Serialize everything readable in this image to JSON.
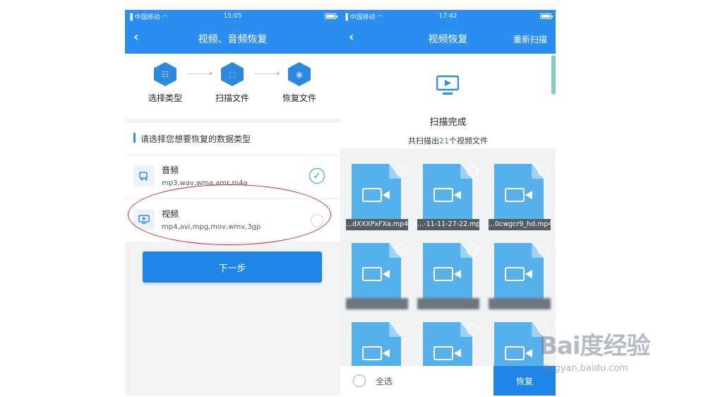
{
  "left_screen": {
    "status": {
      "carrier": "中国移动",
      "time": "15:05"
    },
    "nav": {
      "back_icon": "chevron-left-icon",
      "title": "视频、音频恢复"
    },
    "steps": [
      {
        "label": "选择类型",
        "icon": "grid-icon"
      },
      {
        "label": "扫描文件",
        "icon": "scan-icon"
      },
      {
        "label": "恢复文件",
        "icon": "restore-icon"
      }
    ],
    "section_title": "请选择您想要恢复的数据类型",
    "types": [
      {
        "name": "音频",
        "extensions": "mp3,wav,wma,amr,m4a",
        "selected": true
      },
      {
        "name": "视频",
        "extensions": "mp4,avi,mpg,mov,wmv,3gp",
        "selected": false
      }
    ],
    "next_button": "下一步"
  },
  "right_screen": {
    "status": {
      "carrier": "中国移动",
      "time": "17:42"
    },
    "nav": {
      "back_icon": "chevron-left-icon",
      "title": "视频恢复",
      "rescan": "重新扫描"
    },
    "scan_done": "扫描完成",
    "scan_count": {
      "prefix": "共扫描出",
      "number": "21",
      "suffix": "个视频文件"
    },
    "files": [
      {
        "name": "...dXXXPxFXa.mp4"
      },
      {
        "name": "...-11-11-27-22.mp4"
      },
      {
        "name": "...0cwgcr9_hd.mp4"
      },
      {
        "name": ""
      },
      {
        "name": ""
      },
      {
        "name": ""
      },
      {
        "name": ""
      },
      {
        "name": ""
      },
      {
        "name": ""
      }
    ],
    "select_all": "全选",
    "restore_button": "恢复"
  },
  "watermark": {
    "logo": "Bai度经验",
    "sub": "jingyan.baidu.com"
  },
  "colors": {
    "primary": "#2a8df0",
    "button": "#1f86e8",
    "file_icon": "#55b0ec",
    "highlight": "#e02020"
  }
}
